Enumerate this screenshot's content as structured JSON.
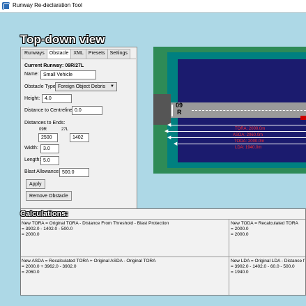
{
  "window": {
    "title": "Runway Re-declaration Tool"
  },
  "view_title": "Top-down view",
  "panel": {
    "tabs": [
      "Runways",
      "Obstacle",
      "XML",
      "Presets",
      "Settings"
    ],
    "current_runway": "Current Runway: 09R/27L",
    "name_label": "Name:",
    "name_value": "Small Vehicle",
    "type_label": "Obstacle Type:",
    "type_value": "Foreign Object Debris",
    "height_label": "Height:",
    "height_value": "4.0",
    "centre_label": "Distance to Centreline:",
    "centre_value": "0.0",
    "ends_label": "Distances to Ends:",
    "end1_label": "09R",
    "end1_value": "2500",
    "end2_label": "27L",
    "end2_value": "1402",
    "width_label": "Width:",
    "width_value": "3.0",
    "length_label": "Length:",
    "length_value": "5.0",
    "blast_label": "Blast Allowance:",
    "blast_value": "500.0",
    "apply_label": "Apply",
    "remove_label": "Remove Obstacle"
  },
  "runway_view": {
    "designator_num": "09",
    "designator_letter": "R",
    "tora_label": "TORA: 2000.0m",
    "asda_label": "ASDA: 2060.0m",
    "toda_label": "TODA: 2000.0m",
    "lda_label": "LDA: 1940.0m",
    "colors": {
      "grass": "#2e8b57",
      "clearway": "#008080",
      "stopway": "#1b1b6e",
      "runway": "#9a9a9a",
      "label": "#ff3030"
    }
  },
  "calculations": {
    "title": "Calculations:",
    "tora": {
      "line1": "New TORA = Original TORA  - Distance From Threshold  - Blast Protection",
      "line2": "= 3902.0  - 1402.0  - 500.0",
      "line3": "= 2000.0"
    },
    "toda": {
      "line1": "New TODA = Recalculated TORA",
      "line2": "= 2000.0",
      "line3": "= 2000.0"
    },
    "asda": {
      "line1": "New ASDA = Recalculated TORA  + Original ASDA  - Original TORA",
      "line2": "= 2000.0  + 3962.0  - 3902.0",
      "line3": "= 2060.0"
    },
    "lda": {
      "line1": "New LDA = Original LDA  - Distance fr",
      "line2": "= 3902.0  - 1402.0  - 60.0  - 500.0",
      "line3": "= 1940.0"
    }
  }
}
